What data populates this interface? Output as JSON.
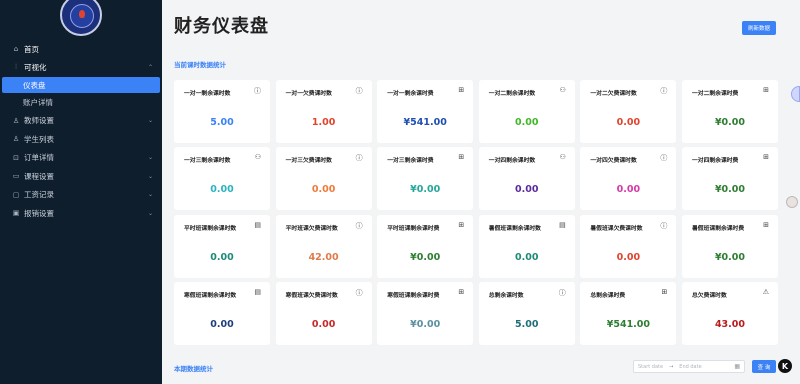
{
  "sidebar": {
    "items": [
      {
        "label": "首页",
        "icon": "home-icon",
        "glyph": "⌂"
      },
      {
        "label": "可视化",
        "icon": "chart-icon",
        "glyph": "⫶",
        "expanded": true
      },
      {
        "label": "仪表盘",
        "sub": true,
        "active": true
      },
      {
        "label": "账户详情",
        "sub": true
      },
      {
        "label": "教师设置",
        "icon": "user-icon",
        "glyph": "♙"
      },
      {
        "label": "学生列表",
        "icon": "user-icon",
        "glyph": "♙"
      },
      {
        "label": "订单详情",
        "icon": "cart-icon",
        "glyph": "⊡"
      },
      {
        "label": "课程设置",
        "icon": "book-icon",
        "glyph": "▭"
      },
      {
        "label": "工资记录",
        "icon": "wallet-icon",
        "glyph": "▢"
      },
      {
        "label": "报销设置",
        "icon": "receipt-icon",
        "glyph": "▣"
      }
    ]
  },
  "header": {
    "title": "财务仪表盘",
    "refresh_label": "刷新数据"
  },
  "sections": {
    "current": "当前课时数据统计",
    "period": "本期数据统计"
  },
  "cards": [
    {
      "label": "一对一剩余课时数",
      "value": "5.00",
      "color": "#3b82f6",
      "icon": "info-icon"
    },
    {
      "label": "一对一欠费课时数",
      "value": "1.00",
      "color": "#e0442e",
      "icon": "info-icon"
    },
    {
      "label": "一对一剩余课时费",
      "value": "¥541.00",
      "color": "#1e4fb3",
      "icon": "money-icon"
    },
    {
      "label": "一对二剩余课时数",
      "value": "0.00",
      "color": "#42b72a",
      "icon": "users-icon"
    },
    {
      "label": "一对二欠费课时数",
      "value": "0.00",
      "color": "#e0442e",
      "icon": "info-icon"
    },
    {
      "label": "一对二剩余课时费",
      "value": "¥0.00",
      "color": "#2e7d32",
      "icon": "money-icon"
    },
    {
      "label": "一对三剩余课时数",
      "value": "0.00",
      "color": "#2bb3c0",
      "icon": "users-icon"
    },
    {
      "label": "一对三欠费课时数",
      "value": "0.00",
      "color": "#f07a3c",
      "icon": "info-icon"
    },
    {
      "label": "一对三剩余课时费",
      "value": "¥0.00",
      "color": "#26a69a",
      "icon": "money-icon"
    },
    {
      "label": "一对四剩余课时数",
      "value": "0.00",
      "color": "#5b2c9c",
      "icon": "users-icon"
    },
    {
      "label": "一对四欠费课时数",
      "value": "0.00",
      "color": "#d63aa8",
      "icon": "info-icon"
    },
    {
      "label": "一对四剩余课时费",
      "value": "¥0.00",
      "color": "#2e7d32",
      "icon": "money-icon"
    },
    {
      "label": "平时班课剩余课时数",
      "value": "0.00",
      "color": "#1e8a7a",
      "icon": "calendar-icon"
    },
    {
      "label": "平时班课欠费课时数",
      "value": "42.00",
      "color": "#e07a4a",
      "icon": "info-icon"
    },
    {
      "label": "平时班课剩余课时费",
      "value": "¥0.00",
      "color": "#2e7d32",
      "icon": "money-icon"
    },
    {
      "label": "暑假班课剩余课时数",
      "value": "0.00",
      "color": "#1e8a7a",
      "icon": "calendar-icon"
    },
    {
      "label": "暑假班课欠费课时数",
      "value": "0.00",
      "color": "#e0442e",
      "icon": "info-icon"
    },
    {
      "label": "暑假班课剩余课时费",
      "value": "¥0.00",
      "color": "#2e7d32",
      "icon": "money-icon"
    },
    {
      "label": "寒假班课剩余课时数",
      "value": "0.00",
      "color": "#1f3f7a",
      "icon": "calendar-icon"
    },
    {
      "label": "寒假班课欠费课时数",
      "value": "0.00",
      "color": "#c62828",
      "icon": "info-icon"
    },
    {
      "label": "寒假班课剩余课时费",
      "value": "¥0.00",
      "color": "#5a8fa0",
      "icon": "money-icon"
    },
    {
      "label": "总剩余课时数",
      "value": "5.00",
      "color": "#1e6e7a",
      "icon": "info-icon"
    },
    {
      "label": "总剩余课时费",
      "value": "¥541.00",
      "color": "#2e7d32",
      "icon": "money-icon"
    },
    {
      "label": "总欠费课时数",
      "value": "43.00",
      "color": "#b71c1c",
      "icon": "warning-icon"
    }
  ],
  "date_range": {
    "start_placeholder": "Start date",
    "separator": "→",
    "end_placeholder": "End date"
  },
  "query_label": "查 询",
  "float_button": "K"
}
